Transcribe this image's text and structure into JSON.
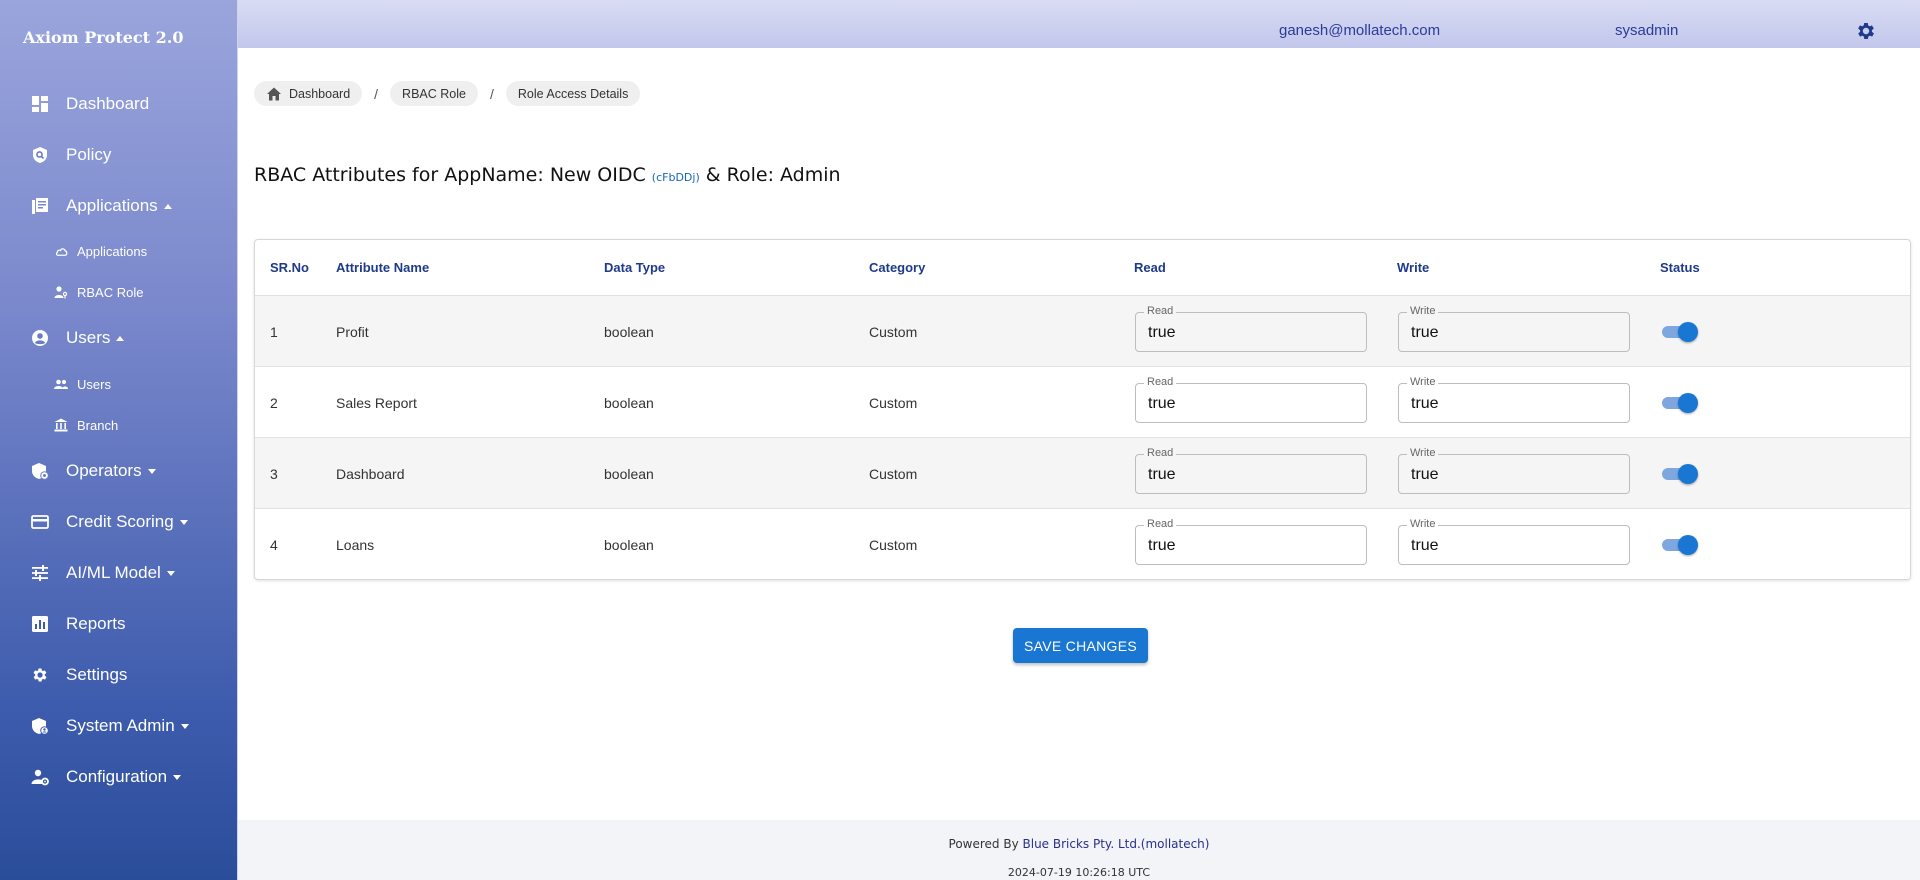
{
  "app": {
    "brand": "Axiom Protect 2.0"
  },
  "sidebar": {
    "items": [
      {
        "label": "Dashboard",
        "icon": "dashboard-icon"
      },
      {
        "label": "Policy",
        "icon": "policy-icon"
      },
      {
        "label": "Applications",
        "icon": "applications-icon",
        "expanded": true
      },
      {
        "label": "Users",
        "icon": "users-icon",
        "expanded": true
      },
      {
        "label": "Operators",
        "icon": "operators-icon"
      },
      {
        "label": "Credit Scoring",
        "icon": "credit-card-icon"
      },
      {
        "label": "AI/ML Model",
        "icon": "sliders-icon"
      },
      {
        "label": "Reports",
        "icon": "reports-icon"
      },
      {
        "label": "Settings",
        "icon": "gear-icon"
      },
      {
        "label": "System Admin",
        "icon": "shield-admin-icon"
      },
      {
        "label": "Configuration",
        "icon": "user-gear-icon"
      }
    ],
    "applications_sub": [
      {
        "label": "Applications",
        "icon": "cloud-icon"
      },
      {
        "label": "RBAC Role",
        "icon": "user-key-icon"
      }
    ],
    "users_sub": [
      {
        "label": "Users",
        "icon": "people-icon"
      },
      {
        "label": "Branch",
        "icon": "bank-icon"
      }
    ]
  },
  "header": {
    "email": "ganesh@mollatech.com",
    "username": "sysadmin"
  },
  "breadcrumb": [
    {
      "label": "Dashboard"
    },
    {
      "label": "RBAC Role"
    },
    {
      "label": "Role Access Details"
    }
  ],
  "heading": {
    "prefix": "RBAC Attributes for AppName: New OIDC ",
    "app_id": "(cFbDDj)",
    "suffix": " & Role: Admin"
  },
  "table": {
    "columns": [
      "SR.No",
      "Attribute Name",
      "Data Type",
      "Category",
      "Read",
      "Write",
      "Status"
    ],
    "read_field_label": "Read",
    "write_field_label": "Write",
    "rows": [
      {
        "sr": "1",
        "name": "Profit",
        "type": "boolean",
        "category": "Custom",
        "read": "true",
        "write": "true",
        "status": true
      },
      {
        "sr": "2",
        "name": "Sales Report",
        "type": "boolean",
        "category": "Custom",
        "read": "true",
        "write": "true",
        "status": true
      },
      {
        "sr": "3",
        "name": "Dashboard",
        "type": "boolean",
        "category": "Custom",
        "read": "true",
        "write": "true",
        "status": true
      },
      {
        "sr": "4",
        "name": "Loans",
        "type": "boolean",
        "category": "Custom",
        "read": "true",
        "write": "true",
        "status": true
      }
    ]
  },
  "actions": {
    "save_label": "SAVE CHANGES"
  },
  "footer": {
    "powered_prefix": "Powered By ",
    "company": "Blue Bricks Pty. Ltd.(mollatech)",
    "timestamp": "2024-07-19 10:26:18 UTC"
  },
  "colors": {
    "accent": "#1976d2",
    "header_text": "#2a3b9a",
    "table_header_text": "#1e3a8a"
  }
}
